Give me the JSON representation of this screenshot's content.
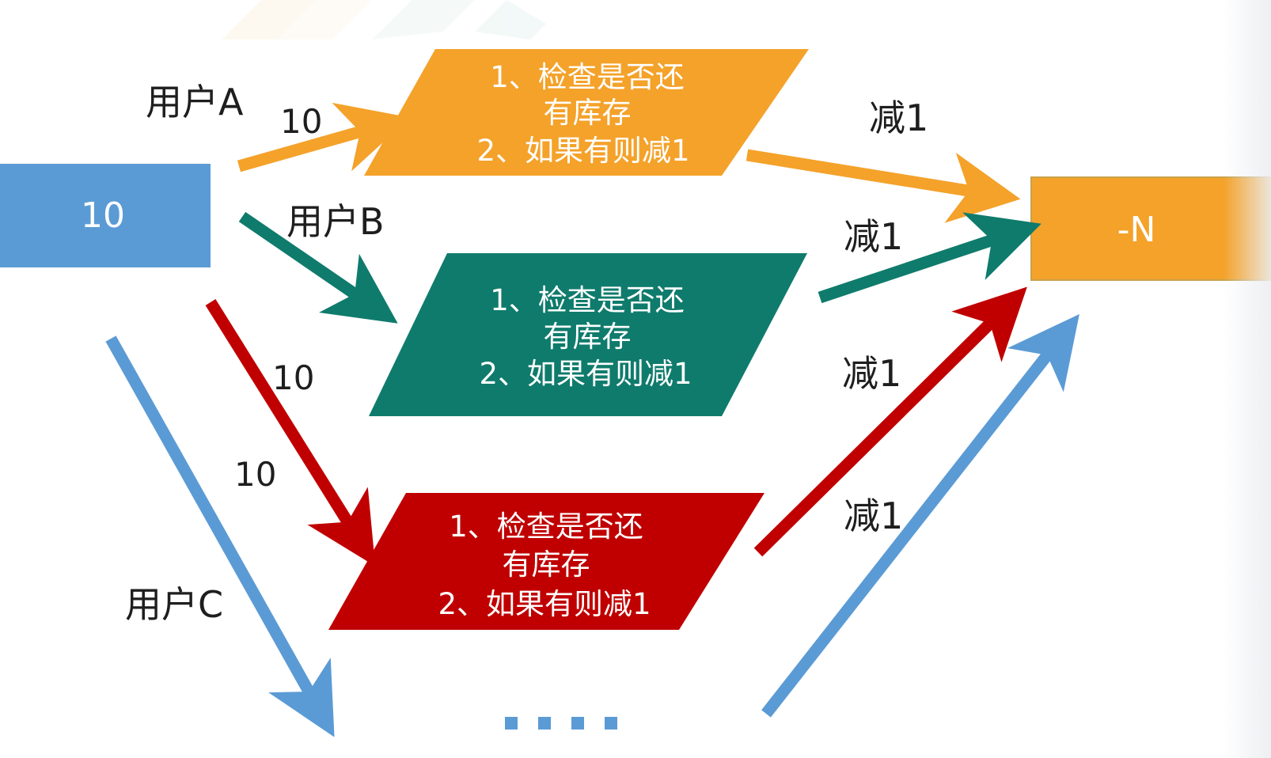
{
  "source_box": {
    "label": "10",
    "color": "#5b9bd5"
  },
  "target_box": {
    "label": "-N",
    "color": "#f4a22a"
  },
  "users": {
    "a": {
      "label": "用户A",
      "amount": "10",
      "color": "#f4a22a"
    },
    "b": {
      "label": "用户B",
      "color": "#0f7b6c"
    },
    "red": {
      "amount": "10",
      "color": "#c00000"
    },
    "c": {
      "label": "用户C",
      "amount": "10",
      "color": "#5b9bd5"
    }
  },
  "process_boxes": [
    {
      "line1": "1、检查是否还",
      "line2": "有库存",
      "line3": "2、如果有则减1",
      "color": "#f4a22a"
    },
    {
      "line1": "1、检查是否还",
      "line2": "有库存",
      "line3": "2、如果有则减1",
      "color": "#0f7b6c"
    },
    {
      "line1": "1、检查是否还",
      "line2": "有库存",
      "line3": "2、如果有则减1",
      "color": "#c00000"
    }
  ],
  "decrement_labels": [
    "减1",
    "减1",
    "减1",
    "减1"
  ],
  "ellipsis": "...."
}
